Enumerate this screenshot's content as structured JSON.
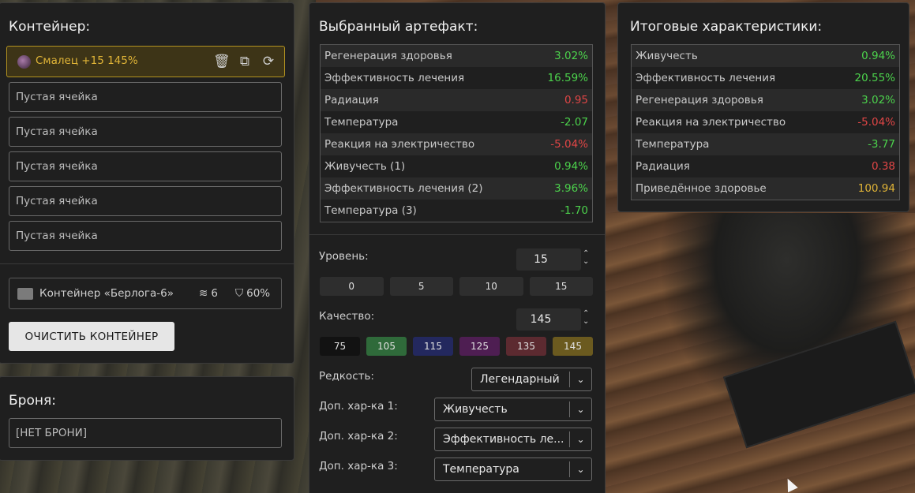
{
  "container": {
    "title": "Контейнер:",
    "selected_cell": "Смалец +15 145%",
    "empty_cells": [
      "Пустая ячейка",
      "Пустая ячейка",
      "Пустая ячейка",
      "Пустая ячейка",
      "Пустая ячейка"
    ],
    "box_name": "Контейнер «Берлога-6»",
    "box_slots": "6",
    "box_protection": "60%",
    "clear_label": "ОЧИСТИТЬ КОНТЕЙНЕР"
  },
  "armor": {
    "title": "Броня:",
    "value": "[НЕТ БРОНИ]"
  },
  "artifact": {
    "title": "Выбранный артефакт:",
    "stats": [
      {
        "name": "Регенерация здоровья",
        "value": "3.02%",
        "tone": "pos"
      },
      {
        "name": "Эффективность лечения",
        "value": "16.59%",
        "tone": "pos"
      },
      {
        "name": "Радиация",
        "value": "0.95",
        "tone": "neg"
      },
      {
        "name": "Температура",
        "value": "-2.07",
        "tone": "pos"
      },
      {
        "name": "Реакция на электричество",
        "value": "-5.04%",
        "tone": "neg"
      },
      {
        "name": "Живучесть (1)",
        "value": "0.94%",
        "tone": "pos"
      },
      {
        "name": "Эффективность лечения (2)",
        "value": "3.96%",
        "tone": "pos"
      },
      {
        "name": "Температура (3)",
        "value": "-1.70",
        "tone": "pos"
      }
    ],
    "level_label": "Уровень:",
    "level_value": "15",
    "level_presets": [
      "0",
      "5",
      "10",
      "15"
    ],
    "quality_label": "Качество:",
    "quality_value": "145",
    "quality_presets": [
      {
        "label": "75",
        "color": "#121212"
      },
      {
        "label": "105",
        "color": "#2f6a3a"
      },
      {
        "label": "115",
        "color": "#23285e"
      },
      {
        "label": "125",
        "color": "#4e1e52"
      },
      {
        "label": "135",
        "color": "#5c2a30"
      },
      {
        "label": "145",
        "color": "#6b5a1f"
      }
    ],
    "rarity_label": "Редкость:",
    "rarity_value": "Легендарный",
    "extra1_label": "Доп. хар-ка 1:",
    "extra1_value": "Живучесть",
    "extra2_label": "Доп. хар-ка 2:",
    "extra2_value": "Эффективность ле...",
    "extra3_label": "Доп. хар-ка 3:",
    "extra3_value": "Температура"
  },
  "totals": {
    "title": "Итоговые характеристики:",
    "stats": [
      {
        "name": "Живучесть",
        "value": "0.94%",
        "tone": "pos"
      },
      {
        "name": "Эффективность лечения",
        "value": "20.55%",
        "tone": "pos"
      },
      {
        "name": "Регенерация здоровья",
        "value": "3.02%",
        "tone": "pos"
      },
      {
        "name": "Реакция на электричество",
        "value": "-5.04%",
        "tone": "neg"
      },
      {
        "name": "Температура",
        "value": "-3.77",
        "tone": "pos"
      },
      {
        "name": "Радиация",
        "value": "0.38",
        "tone": "neg"
      },
      {
        "name": "Приведённое здоровье",
        "value": "100.94",
        "tone": "gold"
      }
    ]
  }
}
